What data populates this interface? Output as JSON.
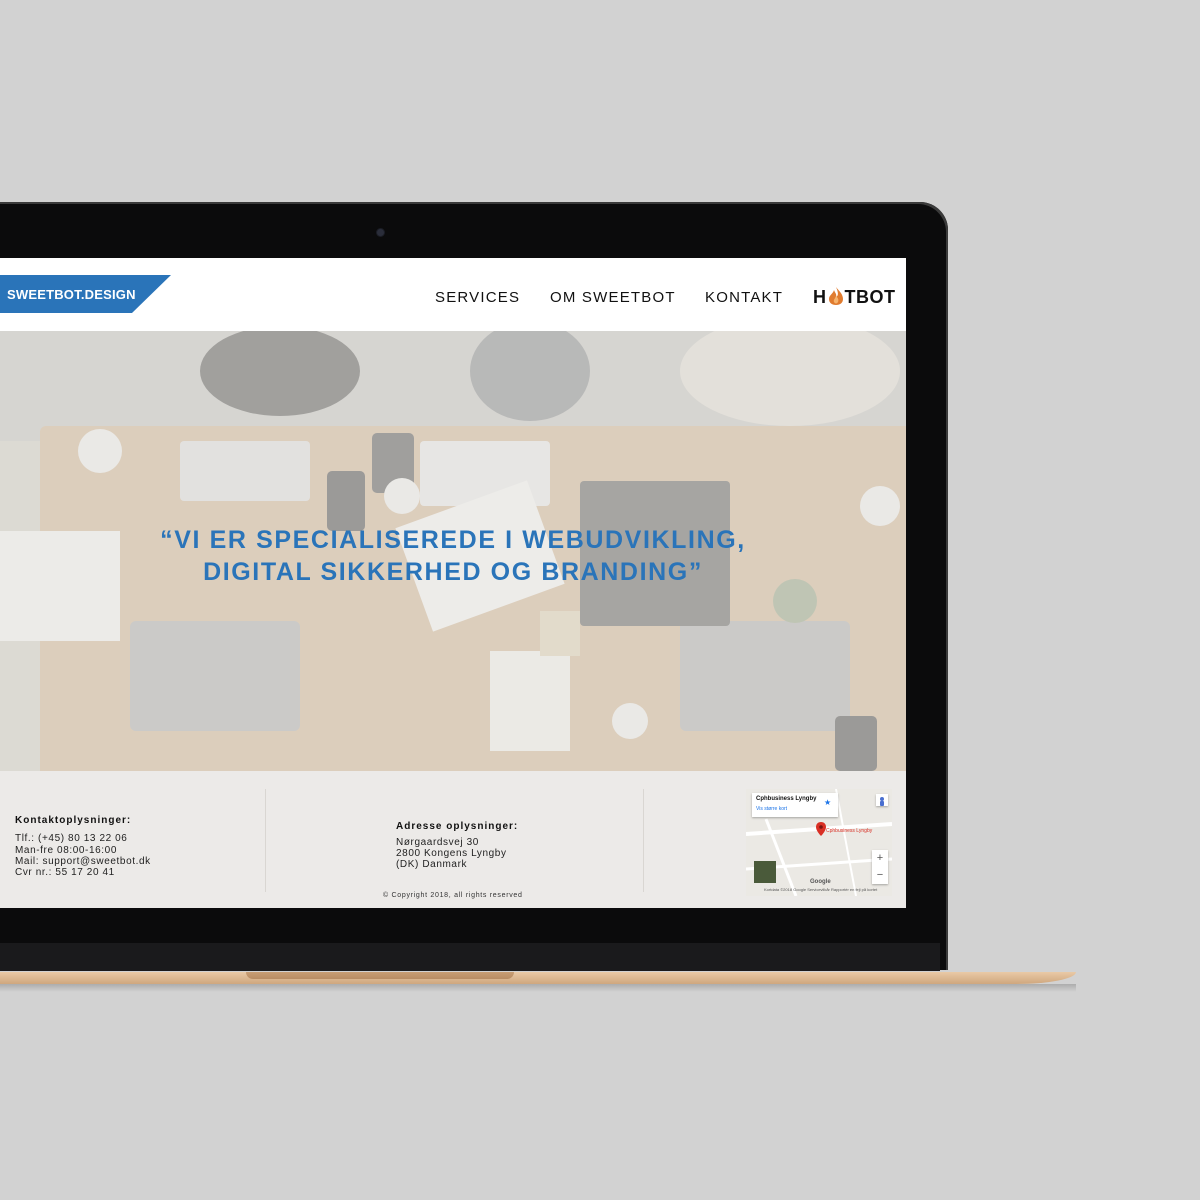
{
  "header": {
    "logo_text": "SWEETBOT.DESIGN",
    "nav": [
      {
        "label": "SERVICES"
      },
      {
        "label": "OM SWEETBOT"
      },
      {
        "label": "KONTAKT"
      }
    ],
    "brand_prefix": "H",
    "brand_suffix": "TBOT",
    "brand_accent": "#e07b2e"
  },
  "hero": {
    "quote_line1": "“VI ER SPECIALISEREDE I WEBUDVIKLING,",
    "quote_line2": "DIGITAL SIKKERHED OG BRANDING”",
    "accent": "#2a74b9"
  },
  "footer": {
    "contact": {
      "title": "Kontaktoplysninger:",
      "lines": [
        "Tlf.: (+45) 80 13 22 06",
        "Man-fre 08:00-16:00",
        "Mail: support@sweetbot.dk",
        "Cvr nr.: 55 17 20 41"
      ]
    },
    "address": {
      "title": "Adresse oplysninger:",
      "lines": [
        "Nørgaardsvej 30",
        "2800 Kongens Lyngby",
        "(DK) Danmark"
      ]
    },
    "copyright": "© Copyright 2018, all rights reserved",
    "map": {
      "place": "Cphbusiness Lyngby",
      "link": "Vis større kort",
      "pin_label": "Cphbusiness Lyngby",
      "google": "Google",
      "attribution": "Kortdata ©2018 Google   Servicevilkår        Rapportér en fejl på kortet",
      "zoom_in": "+",
      "zoom_out": "−"
    }
  }
}
